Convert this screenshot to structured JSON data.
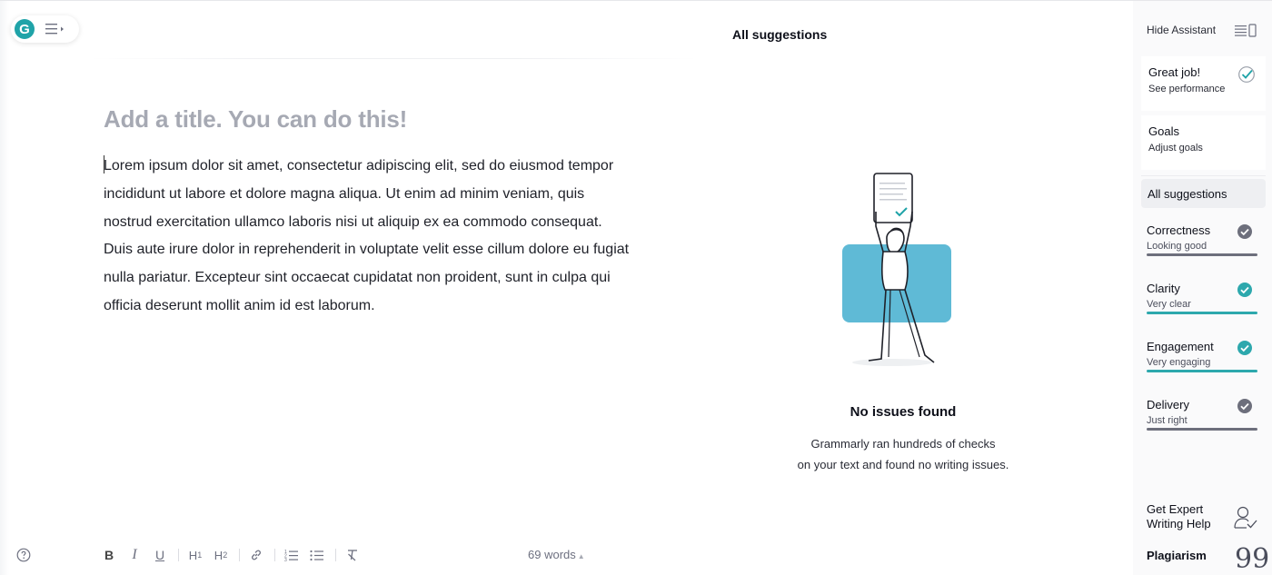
{
  "colors": {
    "accent": "#1fa3a8",
    "neutral_check": "#6d7080",
    "bar_neutral": "#6d6f7c",
    "bar_accent": "#2da8ad"
  },
  "editor": {
    "title_placeholder": "Add a title. You can do this!",
    "body": "Lorem ipsum dolor sit amet, consectetur adipiscing elit, sed do eiusmod tempor incididunt ut labore et dolore magna aliqua. Ut enim ad minim veniam, quis nostrud exercitation ullamco laboris nisi ut aliquip ex ea commodo consequat. Duis aute irure dolor in reprehenderit in voluptate velit esse cillum dolore eu fugiat nulla pariatur. Excepteur sint occaecat cupidatat non proident, sunt in culpa qui officia deserunt mollit anim id est laborum.",
    "logo_letter": "G"
  },
  "toolbar": {
    "bold": "B",
    "italic": "I",
    "underline": "U",
    "h1": "H",
    "h1_sub": "1",
    "h2": "H",
    "h2_sub": "2",
    "word_count": "69 words",
    "word_count_caret": "▲"
  },
  "panel": {
    "title": "All suggestions",
    "no_issues_title": "No issues found",
    "no_issues_line1": "Grammarly ran hundreds of checks",
    "no_issues_line2": "on your text and found no writing issues."
  },
  "sidebar": {
    "hide_assistant": "Hide Assistant",
    "performance": {
      "title": "Great job!",
      "link": "See performance"
    },
    "goals": {
      "title": "Goals",
      "link": "Adjust goals"
    },
    "all_suggestions": "All suggestions",
    "categories": [
      {
        "name": "Correctness",
        "status": "Looking good",
        "state": "neutral"
      },
      {
        "name": "Clarity",
        "status": "Very clear",
        "state": "accent"
      },
      {
        "name": "Engagement",
        "status": "Very engaging",
        "state": "accent"
      },
      {
        "name": "Delivery",
        "status": "Just right",
        "state": "neutral"
      }
    ],
    "expert_help_line1": "Get Expert",
    "expert_help_line2": "Writing Help",
    "plagiarism": "Plagiarism",
    "plagiarism_icon": "99"
  }
}
